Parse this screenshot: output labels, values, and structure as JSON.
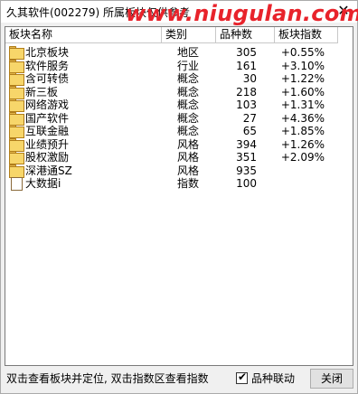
{
  "window": {
    "title": "久其软件(002279) 所属板块仅供参考",
    "close_glyph": "✕",
    "watermark": "www.niugulan.com"
  },
  "table": {
    "headers": [
      "板块名称",
      "类别",
      "品种数",
      "板块指数"
    ],
    "rows": [
      {
        "icon": "folder-icon",
        "name": "北京板块",
        "type": "地区",
        "count": "305",
        "index": "+0.55%"
      },
      {
        "icon": "folder-icon",
        "name": "软件服务",
        "type": "行业",
        "count": "161",
        "index": "+3.10%"
      },
      {
        "icon": "folder-icon",
        "name": "含可转债",
        "type": "概念",
        "count": "30",
        "index": "+1.22%"
      },
      {
        "icon": "folder-icon",
        "name": "新三板",
        "type": "概念",
        "count": "218",
        "index": "+1.60%"
      },
      {
        "icon": "folder-icon",
        "name": "网络游戏",
        "type": "概念",
        "count": "103",
        "index": "+1.31%"
      },
      {
        "icon": "folder-icon",
        "name": "国产软件",
        "type": "概念",
        "count": "27",
        "index": "+4.36%"
      },
      {
        "icon": "folder-icon",
        "name": "互联金融",
        "type": "概念",
        "count": "65",
        "index": "+1.85%"
      },
      {
        "icon": "folder-icon",
        "name": "业绩预升",
        "type": "风格",
        "count": "394",
        "index": "+1.26%"
      },
      {
        "icon": "folder-icon",
        "name": "股权激励",
        "type": "风格",
        "count": "351",
        "index": "+2.09%"
      },
      {
        "icon": "folder-icon",
        "name": "深港通SZ",
        "type": "风格",
        "count": "935",
        "index": ""
      },
      {
        "icon": "document-icon",
        "name": "大数据i",
        "type": "指数",
        "count": "100",
        "index": ""
      }
    ]
  },
  "footer": {
    "status_text": "双击查看板块并定位, 双击指数区查看指数",
    "checkbox_label": "品种联动",
    "checkbox_checked": true,
    "check_glyph": "✔",
    "close_button_label": "关闭"
  }
}
